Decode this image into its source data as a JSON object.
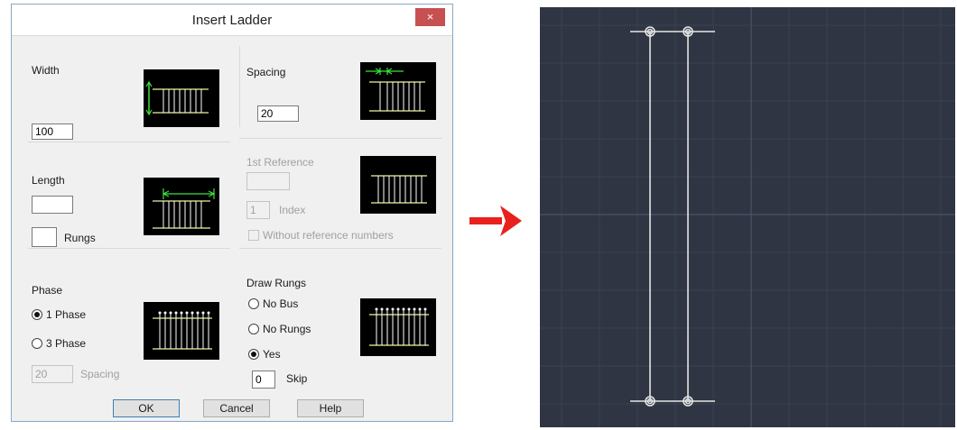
{
  "dialog": {
    "title": "Insert Ladder",
    "close_glyph": "×",
    "width": {
      "label": "Width",
      "value": "100",
      "icon": "ladder-width-icon"
    },
    "spacing": {
      "label": "Spacing",
      "value": "20",
      "icon": "ladder-spacing-icon"
    },
    "length": {
      "label": "Length",
      "value": "",
      "rungs_value": "",
      "rungs_label": "Rungs",
      "icon": "ladder-length-icon"
    },
    "reference": {
      "label": "1st Reference",
      "value": "",
      "index_value": "1",
      "index_label": "Index",
      "without_refs_label": "Without reference numbers",
      "without_refs_checked": false,
      "icon": "ladder-reference-icon"
    },
    "phase": {
      "label": "Phase",
      "options": [
        "1 Phase",
        "3 Phase"
      ],
      "selected": "1 Phase",
      "spacing_value": "20",
      "spacing_label": "Spacing",
      "icon": "ladder-phase-icon"
    },
    "draw_rungs": {
      "label": "Draw Rungs",
      "options": [
        "No Bus",
        "No Rungs",
        "Yes"
      ],
      "selected": "Yes",
      "skip_value": "0",
      "skip_label": "Skip",
      "icon": "ladder-rungs-icon"
    },
    "buttons": {
      "ok": "OK",
      "cancel": "Cancel",
      "help": "Help"
    }
  },
  "arrow": {
    "icon": "right-arrow-icon",
    "color": "#e8211c"
  },
  "cad_view": {
    "background": "#2f3542",
    "grid_color": "#3d4557",
    "ladder_color": "#e6e6e6"
  },
  "colors": {
    "thumb_rail": "#3de13d",
    "thumb_rungs": "#f2f2a0",
    "dialog_bg": "#f0f0f0",
    "close_red": "#c75050"
  }
}
